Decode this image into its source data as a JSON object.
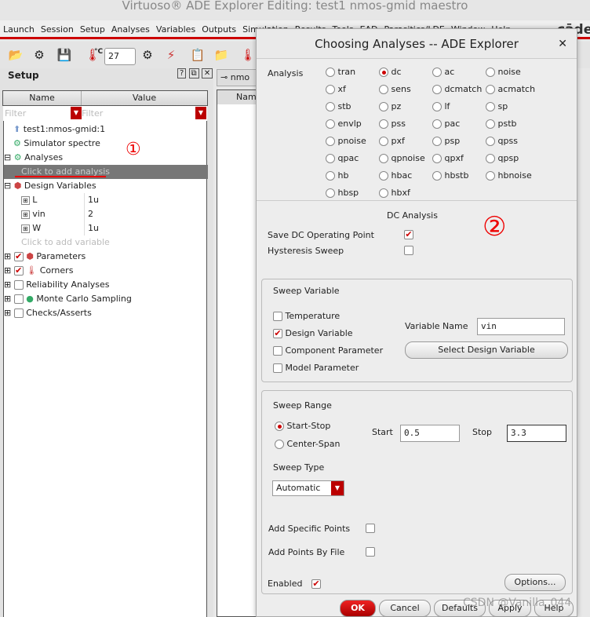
{
  "window": {
    "title": "Virtuoso® ADE Explorer Editing: test1 nmos-gmid maestro",
    "brand": "cāde"
  },
  "menu": [
    "Launch",
    "Session",
    "Setup",
    "Analyses",
    "Variables",
    "Outputs",
    "Simulation",
    "Results",
    "Tools",
    "EAD",
    "Parasitics/LDE",
    "Window",
    "Help"
  ],
  "toolbar": {
    "temperature": "27",
    "temp_unit": "°C"
  },
  "setup": {
    "title": "Setup",
    "col_name": "Name",
    "col_value": "Value",
    "filter_placeholder": "Filter",
    "tab": "nmo",
    "right_col": "Nam",
    "items": [
      {
        "label": "test1:nmos-gmid:1"
      },
      {
        "label": "Simulator  spectre"
      },
      {
        "label": "Analyses"
      },
      {
        "label": "Click to add analysis"
      },
      {
        "label": "Design Variables"
      },
      {
        "label": "Click to add variable"
      },
      {
        "label": "Parameters",
        "checked": true
      },
      {
        "label": "Corners",
        "checked": true
      },
      {
        "label": "Reliability Analyses",
        "checked": false
      },
      {
        "label": "Monte Carlo Sampling",
        "checked": false
      },
      {
        "label": "Checks/Asserts",
        "checked": false
      }
    ],
    "variables": [
      {
        "name": "L",
        "value": "1u"
      },
      {
        "name": "vin",
        "value": "2"
      },
      {
        "name": "W",
        "value": "1u"
      }
    ],
    "annotation": "①"
  },
  "dialog": {
    "title": "Choosing Analyses -- ADE Explorer",
    "analysis_label": "Analysis",
    "analyses": [
      "tran",
      "dc",
      "ac",
      "noise",
      "xf",
      "sens",
      "dcmatch",
      "acmatch",
      "stb",
      "pz",
      "lf",
      "sp",
      "envlp",
      "pss",
      "pac",
      "pstb",
      "pnoise",
      "pxf",
      "psp",
      "qpss",
      "qpac",
      "qpnoise",
      "qpxf",
      "qpsp",
      "hb",
      "hbac",
      "hbstb",
      "hbnoise",
      "hbsp",
      "hbxf"
    ],
    "selected": "dc",
    "section_title": "DC Analysis",
    "annotation": "②",
    "save_op": "Save DC Operating Point",
    "save_op_checked": true,
    "hysteresis": "Hysteresis Sweep",
    "hysteresis_checked": false,
    "sweep_variable": {
      "title": "Sweep Variable",
      "options": [
        "Temperature",
        "Design Variable",
        "Component Parameter",
        "Model Parameter"
      ],
      "checked": "Design Variable",
      "var_name_label": "Variable Name",
      "var_name": "vin",
      "select_button": "Select Design Variable"
    },
    "sweep_range": {
      "title": "Sweep Range",
      "options": [
        "Start-Stop",
        "Center-Span"
      ],
      "selected": "Start-Stop",
      "start_label": "Start",
      "start": "0.5",
      "stop_label": "Stop",
      "stop": "3.3"
    },
    "sweep_type": {
      "label": "Sweep Type",
      "value": "Automatic"
    },
    "specific_points": "Add Specific Points",
    "points_by_file": "Add Points By File",
    "enabled": "Enabled",
    "enabled_checked": true,
    "buttons": {
      "options": "Options...",
      "ok": "OK",
      "cancel": "Cancel",
      "defaults": "Defaults",
      "apply": "Apply",
      "help": "Help"
    }
  },
  "watermark": "CSDN @Vanilla_044"
}
